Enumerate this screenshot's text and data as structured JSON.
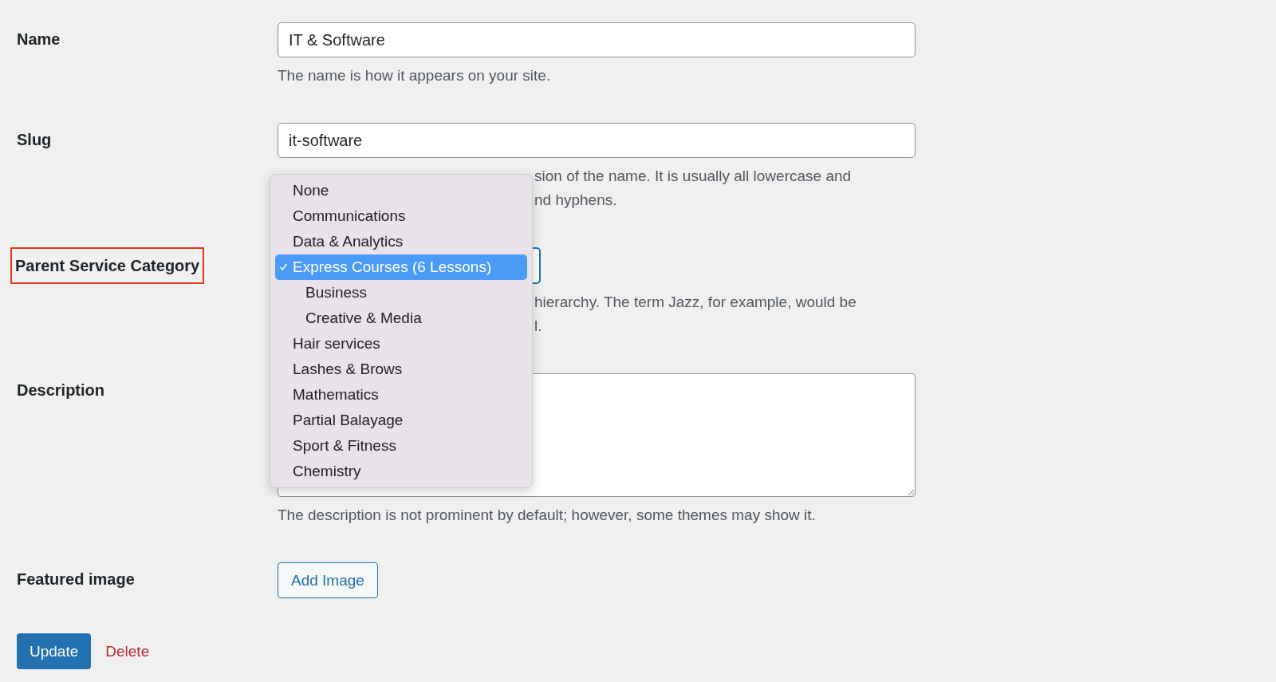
{
  "fields": [
    {
      "kind": "text",
      "label": "Name",
      "value": "IT & Software",
      "hint": [
        "The name is how it appears on your site."
      ]
    },
    {
      "kind": "text",
      "label": "Slug",
      "value": "it-software",
      "hint": [
        "sion of the name. It is usually all lowercase and",
        "nd hyphens."
      ]
    },
    {
      "kind": "select",
      "label": "Parent Service Category",
      "highlighted": true,
      "hint": [
        "hierarchy. The term Jazz, for example, would be",
        "l."
      ]
    },
    {
      "kind": "textarea",
      "label": "Description",
      "hint": [
        "The description is not prominent by default; however, some themes may show it."
      ]
    },
    {
      "kind": "button",
      "label": "Featured image",
      "button": "Add Image"
    }
  ],
  "dropdown": {
    "options": [
      {
        "label": "None",
        "selected": false
      },
      {
        "label": "Communications",
        "selected": false
      },
      {
        "label": "Data & Analytics",
        "selected": false
      },
      {
        "label": "Express Courses (6 Lessons)",
        "selected": true,
        "children": [
          {
            "label": "Business",
            "selected": false
          },
          {
            "label": "Creative & Media",
            "selected": false
          }
        ]
      },
      {
        "label": "Hair services",
        "selected": false
      },
      {
        "label": "Lashes & Brows",
        "selected": false
      },
      {
        "label": "Mathematics",
        "selected": false
      },
      {
        "label": "Partial Balayage",
        "selected": false
      },
      {
        "label": "Sport & Fitness",
        "selected": false
      },
      {
        "label": "Chemistry",
        "selected": false
      }
    ]
  },
  "actions": {
    "primary": "Update",
    "delete": "Delete"
  }
}
